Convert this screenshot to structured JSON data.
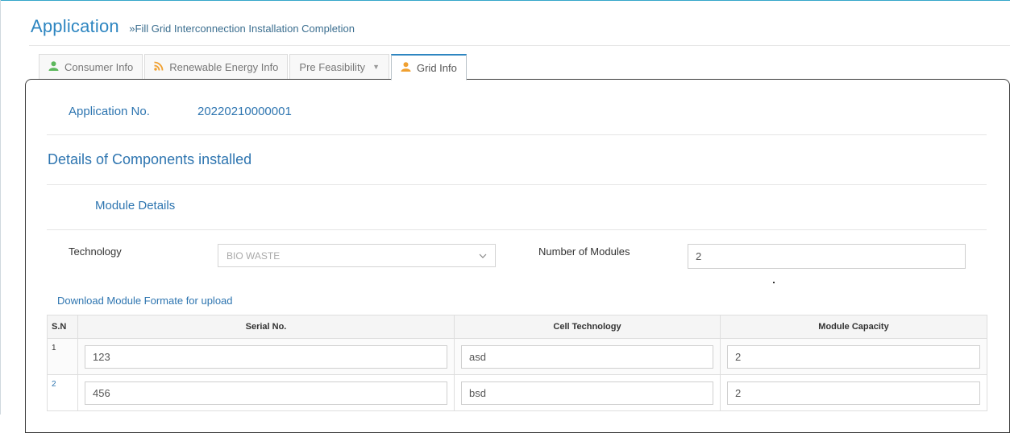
{
  "header": {
    "title": "Application",
    "breadcrumb": "»Fill Grid Interconnection Installation Completion"
  },
  "tabs": [
    {
      "label": "Consumer Info",
      "icon": "user-icon",
      "color": "#5cb85c"
    },
    {
      "label": "Renewable Energy Info",
      "icon": "rss-icon",
      "color": "#f0a030"
    },
    {
      "label": "Pre Feasibility",
      "icon": "chevron-down-icon"
    },
    {
      "label": "Grid Info",
      "icon": "user-icon",
      "color": "#f0a030",
      "active": true
    }
  ],
  "application": {
    "label": "Application No.",
    "number": "20220210000001"
  },
  "section": {
    "title": "Details of Components installed",
    "subtitle": "Module Details"
  },
  "form": {
    "technology_label": "Technology",
    "technology_value": "BIO WASTE",
    "modules_label": "Number of Modules",
    "modules_value": "2"
  },
  "download_link": "Download Module Formate for upload",
  "table": {
    "headers": [
      "S.N",
      "Serial No.",
      "Cell Technology",
      "Module Capacity"
    ],
    "rows": [
      {
        "sn": "1",
        "serial": "123",
        "cell": "asd",
        "capacity": "2"
      },
      {
        "sn": "2",
        "serial": "456",
        "cell": "bsd",
        "capacity": "2"
      }
    ]
  },
  "colors": {
    "accent": "#2e86c1",
    "green_icon": "#5cb85c",
    "orange_icon": "#f0a030"
  }
}
